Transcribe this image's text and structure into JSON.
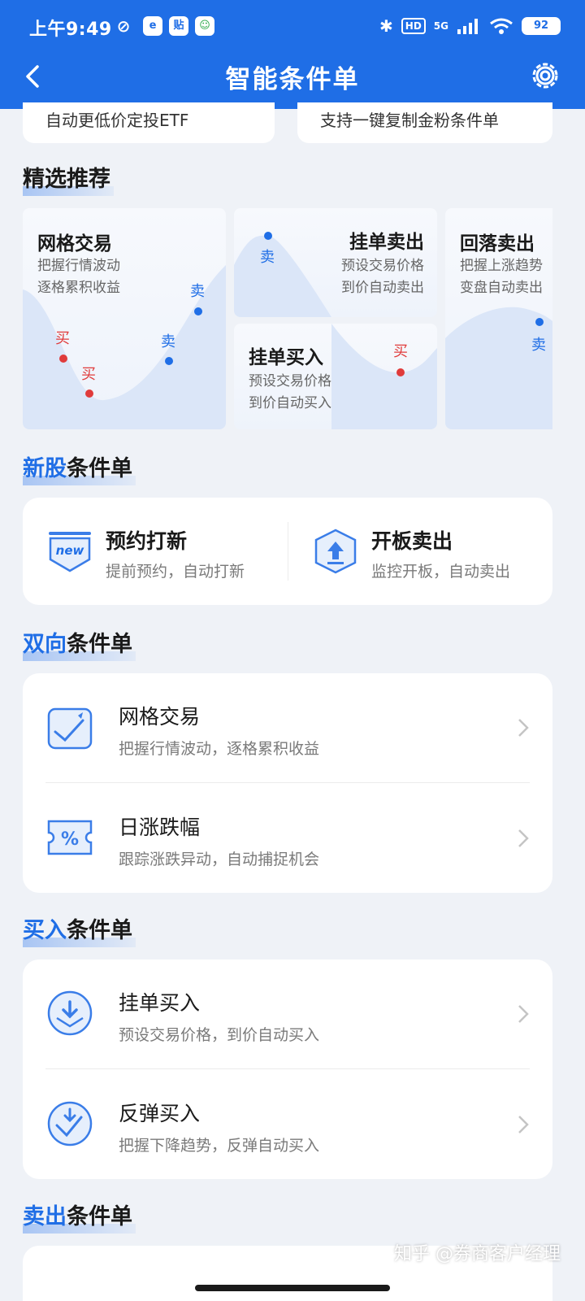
{
  "status": {
    "time": "上午9:49",
    "network": "5G",
    "hd": "HD",
    "battery": "92"
  },
  "nav": {
    "title": "智能条件单"
  },
  "peek_cards": [
    {
      "label": "自动更低价定投ETF"
    },
    {
      "label": "支持一键复制金粉条件单"
    }
  ],
  "featured": {
    "title": "精选推荐",
    "cards": [
      {
        "title": "网格交易",
        "desc1": "把握行情波动",
        "desc2": "逐格累积收益",
        "buy": "买",
        "sell": "卖"
      },
      {
        "title": "挂单卖出",
        "desc1": "预设交易价格",
        "desc2": "到价自动卖出",
        "sell": "卖"
      },
      {
        "title": "挂单买入",
        "desc1": "预设交易价格",
        "desc2": "到价自动买入",
        "buy": "买"
      },
      {
        "title": "回落卖出",
        "desc1": "把握上涨趋势",
        "desc2": "变盘自动卖出",
        "sell": "卖"
      }
    ]
  },
  "sections": {
    "ipo": {
      "hl": "新股",
      "rest": "条件单",
      "items": [
        {
          "title": "预约打新",
          "desc": "提前预约，自动打新",
          "icon_text": "new"
        },
        {
          "title": "开板卖出",
          "desc": "监控开板，自动卖出"
        }
      ]
    },
    "two_way": {
      "hl": "双向",
      "rest": "条件单",
      "items": [
        {
          "title": "网格交易",
          "desc": "把握行情波动，逐格累积收益"
        },
        {
          "title": "日涨跌幅",
          "desc": "跟踪涨跌异动，自动捕捉机会",
          "icon_text": "%"
        }
      ]
    },
    "buy": {
      "hl": "买入",
      "rest": "条件单",
      "items": [
        {
          "title": "挂单买入",
          "desc": "预设交易价格，到价自动买入"
        },
        {
          "title": "反弹买入",
          "desc": "把握下降趋势，反弹自动买入"
        }
      ]
    },
    "sell": {
      "hl": "卖出",
      "rest": "条件单"
    }
  },
  "watermark": "知乎 @券商客户经理",
  "colors": {
    "primary": "#1f6ee6",
    "buy": "#e03b3b",
    "sell": "#1f6ee6"
  }
}
